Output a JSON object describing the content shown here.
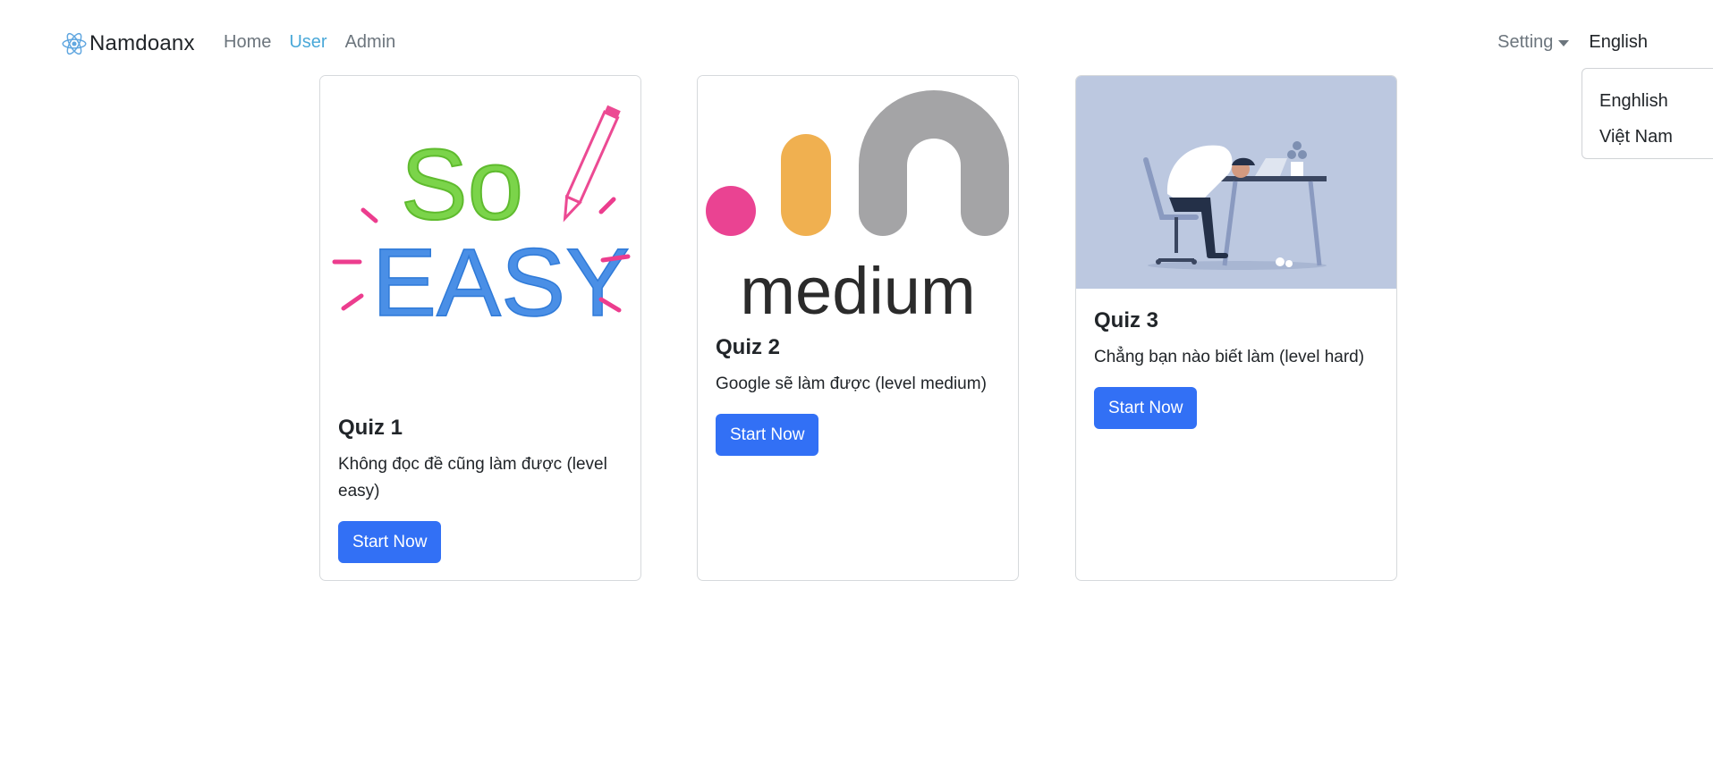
{
  "navbar": {
    "brand": "Namdoanx",
    "links": [
      {
        "label": "Home",
        "active": false
      },
      {
        "label": "User",
        "active": true
      },
      {
        "label": "Admin",
        "active": false
      }
    ],
    "setting_label": "Setting",
    "language_label": "English"
  },
  "language_dropdown": {
    "items": [
      "Enghlish",
      "Việt Nam"
    ]
  },
  "quizzes": [
    {
      "image_text": [
        "So",
        "EASY"
      ],
      "title": "Quiz 1",
      "description": "Không đọc đề cũng làm được (level easy)",
      "button": "Start Now"
    },
    {
      "image_text": "medium",
      "title": "Quiz 2",
      "description": "Google sẽ làm được (level medium)",
      "button": "Start Now"
    },
    {
      "title": "Quiz 3",
      "description": "Chẳng bạn nào biết làm (level hard)",
      "button": "Start Now"
    }
  ],
  "colors": {
    "primary_button": "#3270f5",
    "active_link": "#4aa8d8",
    "muted_link": "#6c757d"
  }
}
